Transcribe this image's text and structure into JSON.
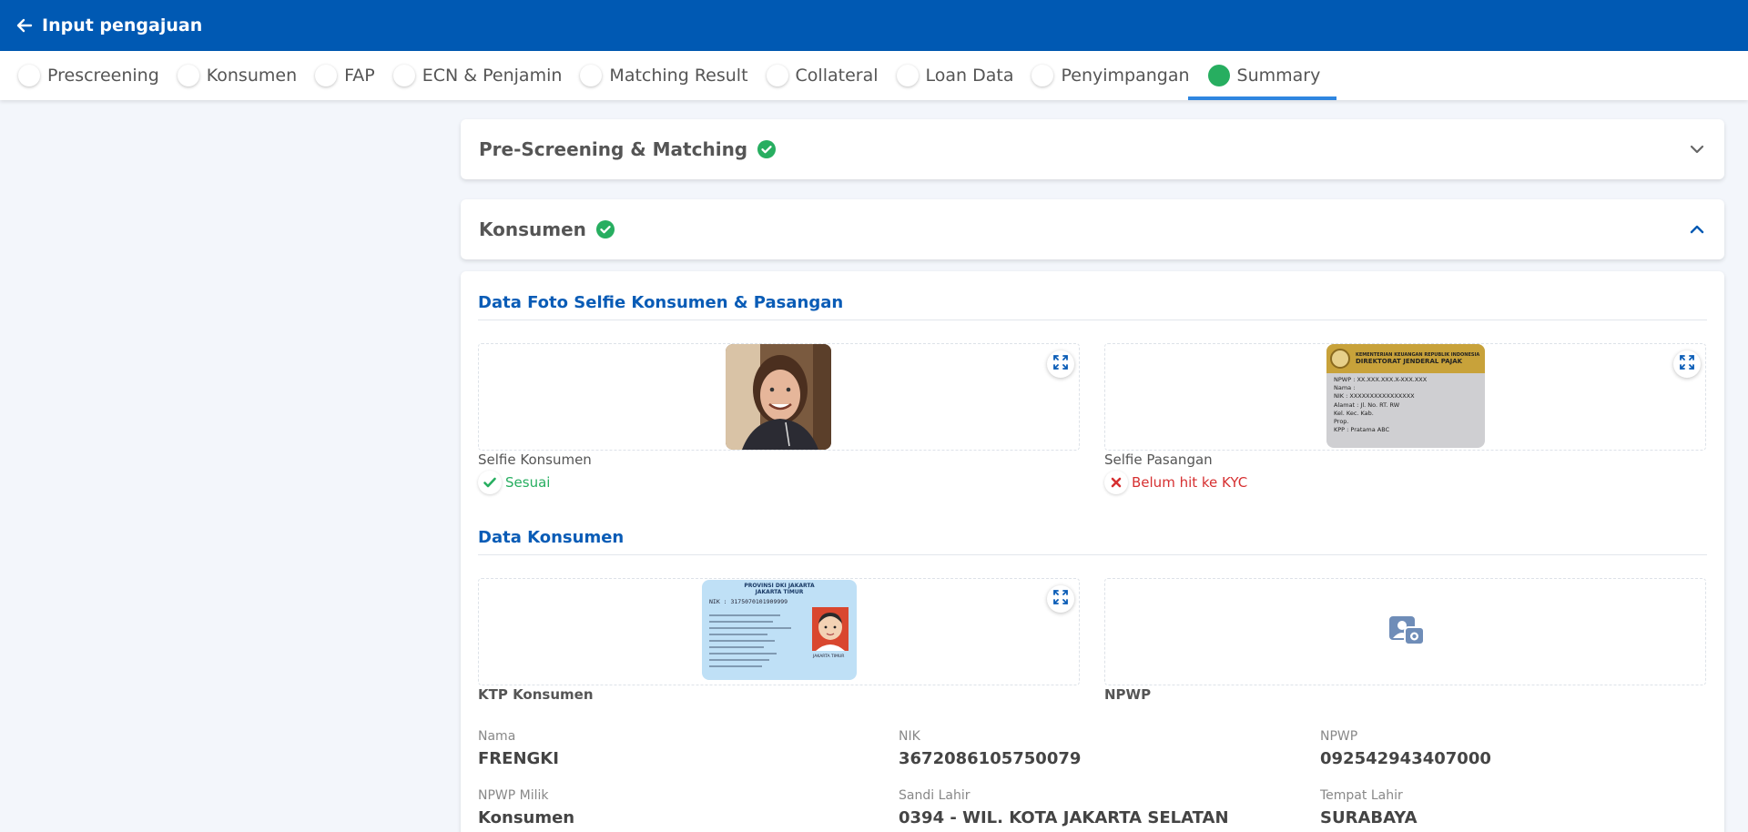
{
  "header": {
    "title": "Input pengajuan"
  },
  "steps": [
    {
      "label": "Prescreening",
      "active": false
    },
    {
      "label": "Konsumen",
      "active": false
    },
    {
      "label": "FAP",
      "active": false
    },
    {
      "label": "ECN & Penjamin",
      "active": false
    },
    {
      "label": "Matching Result",
      "active": false
    },
    {
      "label": "Collateral",
      "active": false
    },
    {
      "label": "Loan Data",
      "active": false
    },
    {
      "label": "Penyimpangan",
      "active": false
    },
    {
      "label": "Summary",
      "active": true
    }
  ],
  "accordions": {
    "prescreening": {
      "title": "Pre-Screening & Matching",
      "state": "collapsed"
    },
    "konsumen": {
      "title": "Konsumen",
      "state": "expanded"
    }
  },
  "selfie_section": {
    "title": "Data Foto Selfie Konsumen & Pasangan",
    "items": [
      {
        "label": "Selfie Konsumen",
        "status": "Sesuai",
        "status_type": "success"
      },
      {
        "label": "Selfie Pasangan",
        "status": "Belum hit ke KYC",
        "status_type": "error"
      }
    ]
  },
  "npwp_card": {
    "header_line1": "KEMENTERIAN KEUANGAN REPUBLIK INDONESIA",
    "header_line2": "DIREKTORAT JENDERAL PAJAK",
    "lines": [
      "NPWP : XX.XXX.XXX.X-XXX.XXX",
      "Nama :",
      "NIK : XXXXXXXXXXXXXXXX",
      "Alamat : Jl. No. RT. RW",
      "Kel. Kec. Kab.",
      "Prop.",
      "KPP : Pratama ABC"
    ]
  },
  "ktp_card": {
    "header_line1": "PROVINSI DKI JAKARTA",
    "header_line2": "JAKARTA TIMUR",
    "nik_line": "NIK : 3175070101909999",
    "caption": "JAKARTA TIMUR"
  },
  "data_konsumen": {
    "title": "Data Konsumen",
    "docs": [
      {
        "label": "KTP Konsumen"
      },
      {
        "label": "NPWP"
      }
    ],
    "fields": [
      {
        "label": "Nama",
        "value": "FRENGKI"
      },
      {
        "label": "NIK",
        "value": "3672086105750079"
      },
      {
        "label": "NPWP",
        "value": "092542943407000"
      },
      {
        "label": "NPWP Milik",
        "value": "Konsumen"
      },
      {
        "label": "Sandi Lahir",
        "value": "0394 - WIL. KOTA JAKARTA SELATAN"
      },
      {
        "label": "Tempat Lahir",
        "value": "SURABAYA"
      }
    ]
  },
  "colors": {
    "primary": "#0059b3",
    "success": "#27ae60",
    "error": "#d63031",
    "tab_underline": "#2f86e0"
  }
}
